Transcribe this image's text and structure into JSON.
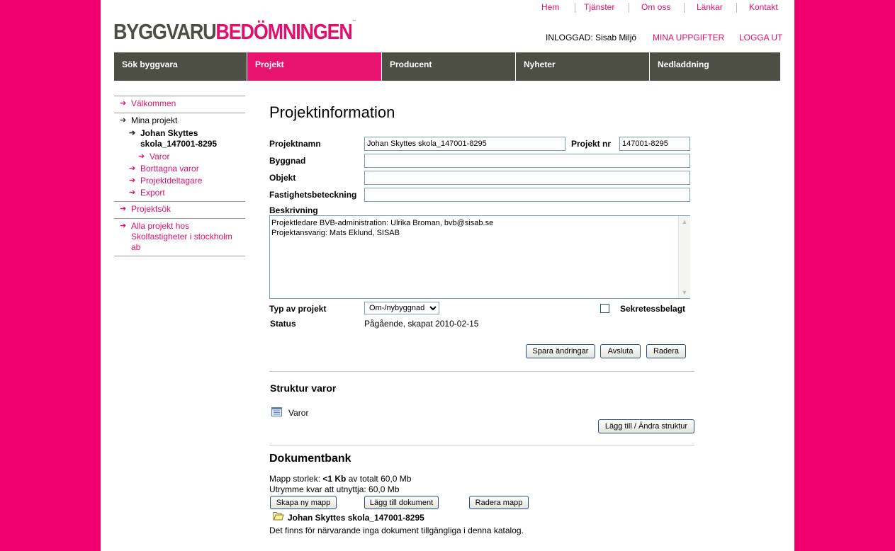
{
  "top_links": [
    "Hem",
    "Tjänster",
    "Om oss",
    "Länkar",
    "Kontakt"
  ],
  "logo": {
    "part1": "BYGGVARU",
    "part2": "BEDÖMNINGEN",
    "mark": "™"
  },
  "user_bar": {
    "logged_in_label": "INLOGGAD:",
    "user_name": "Sisab Miljö",
    "my_details": "MINA UPPGIFTER",
    "logout": "LOGGA UT"
  },
  "nav": [
    "Sök byggvara",
    "Projekt",
    "Producent",
    "Nyheter",
    "Nedladdning"
  ],
  "sidebar": {
    "welcome": "Välkommen",
    "my_projects": "Mina projekt",
    "project_line1": "Johan Skyttes",
    "project_line2": "skola_147001-8295",
    "goods": "Varor",
    "removed_goods": "Borttagna varor",
    "participants": "Projektdeltagare",
    "export": "Export",
    "project_search": "Projektsök",
    "all_projects_line1": "Alla projekt hos",
    "all_projects_line2": "Skolfastigheter i stockholm",
    "all_projects_line3": "ab"
  },
  "form": {
    "title": "Projektinformation",
    "name_label": "Projektnamn",
    "name_value": "Johan Skyttes skola_147001-8295",
    "nr_label": "Projekt nr",
    "nr_value": "147001-8295",
    "building_label": "Byggnad",
    "building_value": "",
    "object_label": "Objekt",
    "object_value": "",
    "property_label": "Fastighetsbeteckning",
    "property_value": "",
    "description_label": "Beskrivning",
    "description_value": "Projektledare BVB-administration: Ulrika Broman, bvb@sisab.se\nProjektansvarig: Mats Eklund, SISAB",
    "type_label": "Typ av projekt",
    "type_value": "Om-/nybyggnad",
    "confidential_label": "Sekretessbelagt",
    "confidential_checked": false,
    "status_label": "Status",
    "status_value": "Pågående, skapat 2010-02-15",
    "save_button": "Spara ändringar",
    "finish_button": "Avsluta",
    "delete_button": "Radera"
  },
  "structure": {
    "title": "Struktur varor",
    "item": "Varor",
    "edit_button": "Lägg till / Ändra struktur"
  },
  "docbank": {
    "title": "Dokumentbank",
    "size_prefix": "Mapp storlek:",
    "size_value": "<1 Kb",
    "size_suffix": "av totalt 60,0 Mb",
    "space_left": "Utrymme kvar att utnyttja: 60,0 Mb",
    "new_folder_button": "Skapa ny mapp",
    "add_doc_button": "Lägg till dokument",
    "delete_folder_button": "Radera mapp",
    "folder_name": "Johan Skyttes skola_147001-8295",
    "empty_message": "Det finns för närvarande inga dokument tillgängliga i denna katalog."
  },
  "colors": {
    "brand_pink": "#e0106e",
    "nav_dark": "#4d4f45",
    "nav_active": "#e8126f"
  }
}
